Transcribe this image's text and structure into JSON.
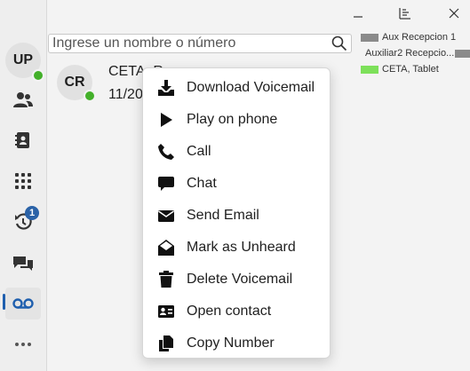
{
  "window": {
    "controls": [
      "minimize-icon",
      "layout-icon",
      "close-icon"
    ]
  },
  "user": {
    "initials": "UP",
    "status_color": "#43b02a"
  },
  "sidebar": {
    "items": [
      {
        "name": "contacts",
        "icon": "people-icon"
      },
      {
        "name": "address-book",
        "icon": "address-book-icon"
      },
      {
        "name": "dialpad",
        "icon": "dialpad-icon"
      },
      {
        "name": "history",
        "icon": "history-icon",
        "badge": "1"
      },
      {
        "name": "chat",
        "icon": "chat-icon"
      },
      {
        "name": "voicemail",
        "icon": "voicemail-icon",
        "active": true
      },
      {
        "name": "more",
        "icon": "more-icon"
      }
    ],
    "accent": "#1f5fae"
  },
  "search": {
    "placeholder": "Ingrese un nombre o número"
  },
  "contacts_list": [
    {
      "label": "Aux Recepcion 1",
      "status_color": "#8a8a8a"
    },
    {
      "label": "Auxiliar2 Recepcio...",
      "status_color": "#8a8a8a"
    },
    {
      "label": "CETA, Tablet",
      "status_color": "#7de05a"
    }
  ],
  "voicemail": {
    "initials": "CR",
    "name": "CETA, R",
    "date": "11/20"
  },
  "context_menu": {
    "items": [
      {
        "label": "Download Voicemail",
        "icon": "download-icon"
      },
      {
        "label": "Play on phone",
        "icon": "play-icon"
      },
      {
        "label": "Call",
        "icon": "phone-icon"
      },
      {
        "label": "Chat",
        "icon": "chat-bubble-icon"
      },
      {
        "label": "Send Email",
        "icon": "envelope-icon"
      },
      {
        "label": "Mark as Unheard",
        "icon": "open-envelope-icon"
      },
      {
        "label": "Delete Voicemail",
        "icon": "trash-icon"
      },
      {
        "label": "Open contact",
        "icon": "contact-card-icon"
      },
      {
        "label": "Copy Number",
        "icon": "copy-icon"
      }
    ]
  }
}
